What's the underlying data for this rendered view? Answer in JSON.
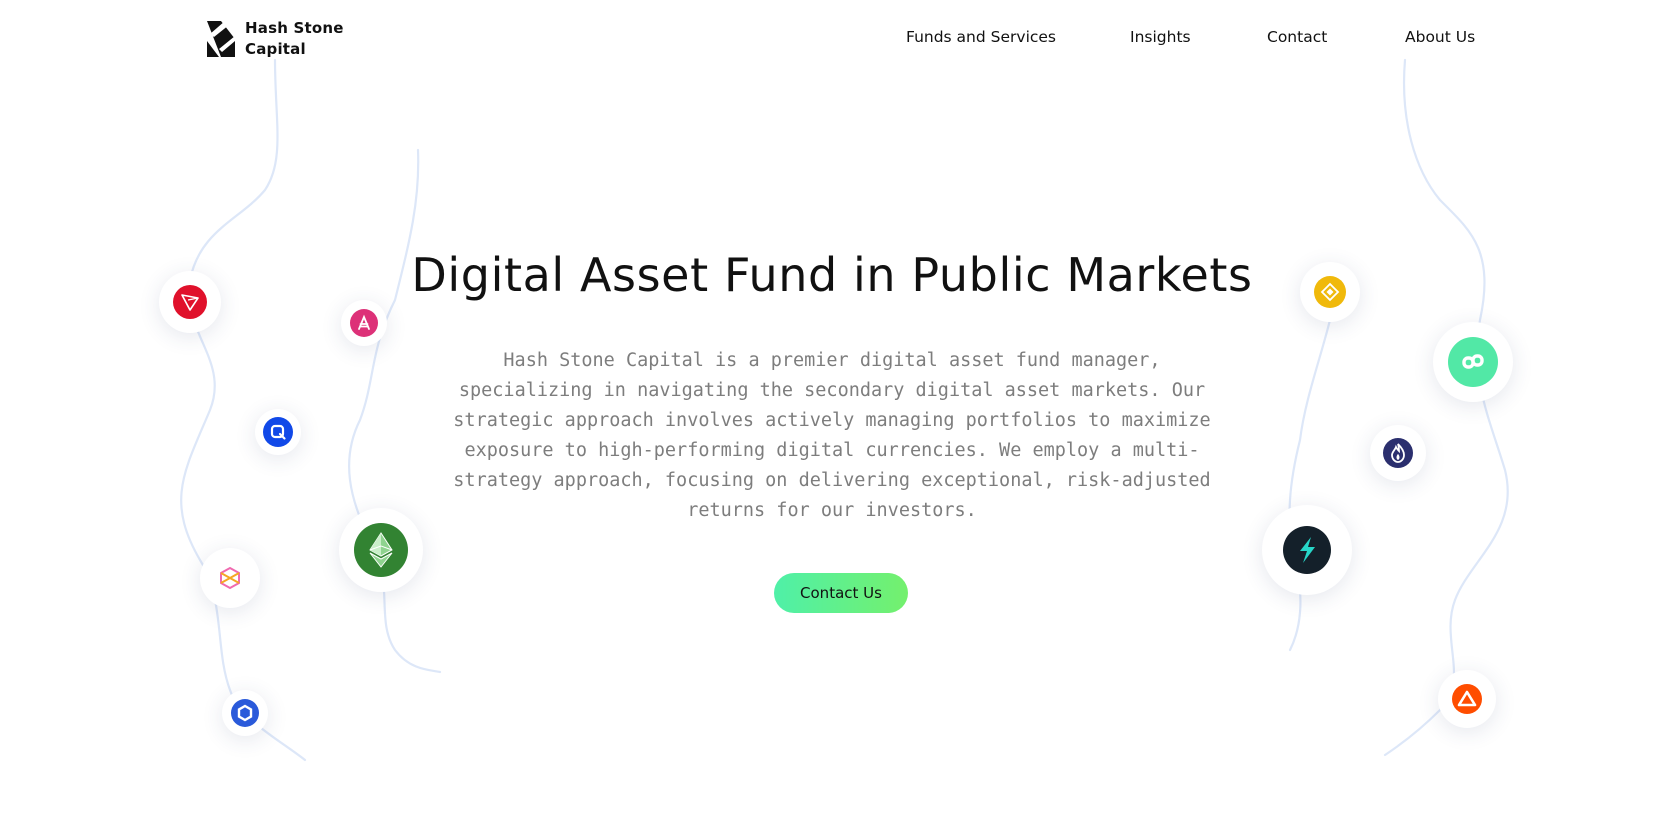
{
  "header": {
    "logo_line1": "Hash Stone",
    "logo_line2": "Capital",
    "nav": [
      {
        "label": "Funds and Services"
      },
      {
        "label": "Insights"
      },
      {
        "label": "Contact"
      },
      {
        "label": "About Us"
      }
    ]
  },
  "hero": {
    "title": "Digital Asset Fund in Public Markets",
    "description": "Hash Stone Capital is a premier digital asset fund manager, specializing in navigating the secondary digital asset markets. Our strategic approach involves actively managing portfolios to maximize exposure to high-performing digital currencies. We employ a multi-strategy approach, focusing on delivering exceptional, risk-adjusted returns for our investors.",
    "cta_label": "Contact Us"
  },
  "coins": [
    {
      "name": "tron-icon",
      "color": "#e0112b"
    },
    {
      "name": "cash-icon",
      "color": "#dd3178"
    },
    {
      "name": "quant-icon",
      "color": "#1149e8"
    },
    {
      "name": "ethereum-classic-icon",
      "color": "#328332"
    },
    {
      "name": "cube-icon",
      "color": "#f06ab0"
    },
    {
      "name": "chainlink-icon",
      "color": "#2a5ada"
    },
    {
      "name": "bnb-icon",
      "color": "#f0b90b"
    },
    {
      "name": "flow-icon",
      "color": "#00ef8b"
    },
    {
      "name": "flame-icon",
      "color": "#2b2f6e"
    },
    {
      "name": "thunder-icon",
      "color": "#14202a"
    },
    {
      "name": "arrow-icon",
      "color": "#ff4d00"
    }
  ],
  "colors": {
    "cta_gradient_start": "#4ff0a8",
    "cta_gradient_end": "#74f06d",
    "curve": "#dfe8f8",
    "text_muted": "#7d7d7d"
  }
}
